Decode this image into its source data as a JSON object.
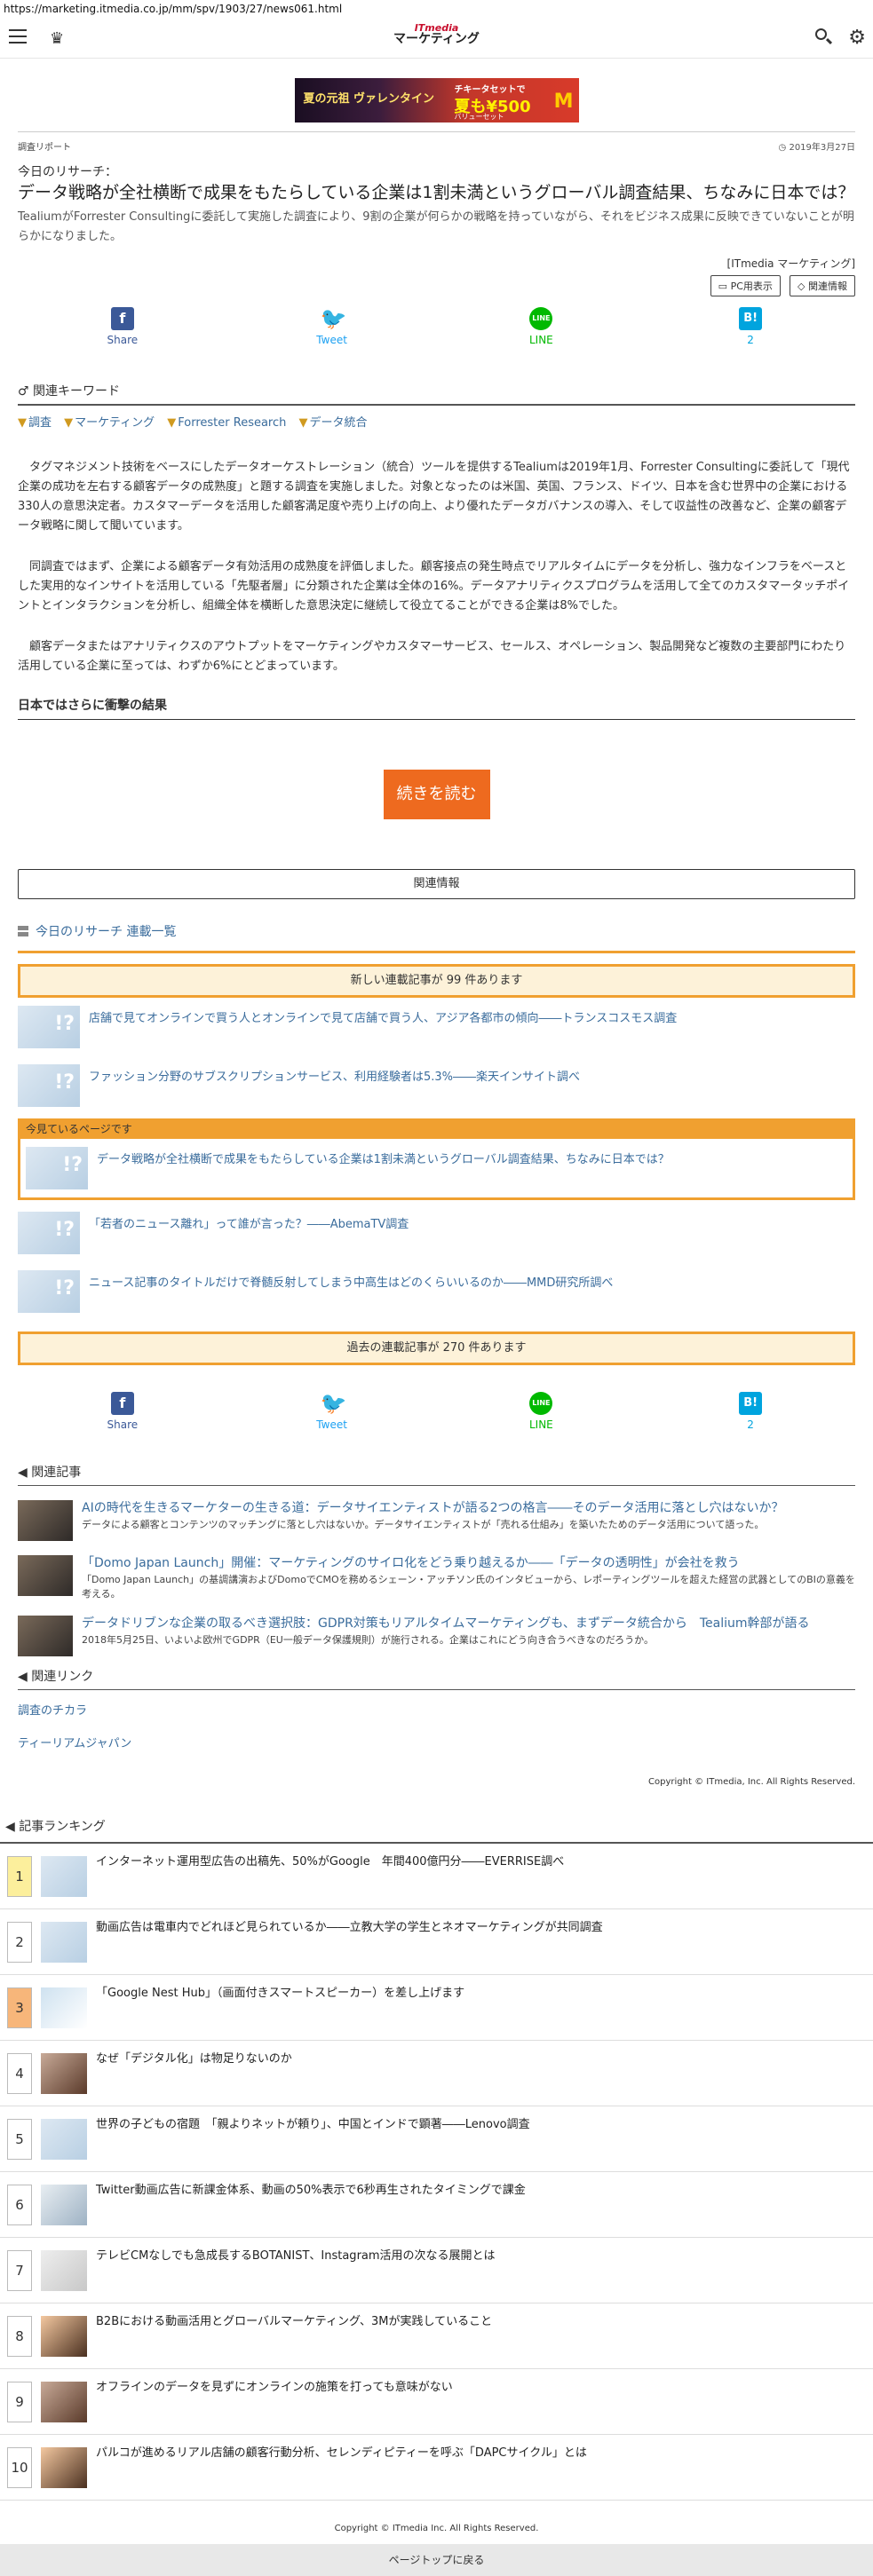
{
  "url": "https://marketing.itmedia.co.jp/mm/spv/1903/27/news061.html",
  "header": {
    "logo_line1": "ITmedia",
    "logo_line2": "マーケティング"
  },
  "ad": {
    "text1": "夏の元祖 ヴァレンタイン",
    "text2": "チキータセットで",
    "text3": "夏も¥500",
    "text4": "バリューセット",
    "mark": "M"
  },
  "meta": {
    "category": "調査リポート",
    "date": "2019年3月27日"
  },
  "article": {
    "kicker": "今日のリサーチ：",
    "title": "データ戦略が全社横断で成果をもたらしている企業は1割未満というグローバル調査結果、ちなみに日本では？",
    "lead": "TealiumがForrester Consultingに委託して実施した調査により、9割の企業が何らかの戦略を持っていながら、それをビジネス成果に反映できていないことが明らかになりました。",
    "byline": "[ITmedia マーケティング]",
    "pc_button": "PC用表示",
    "related_button": "関連情報",
    "paragraphs": [
      "タグマネジメント技術をベースにしたデータオーケストレーション（統合）ツールを提供するTealiumは2019年1月、Forrester Consultingに委託して「現代企業の成功を左右する顧客データの成熟度」と題する調査を実施しました。対象となったのは米国、英国、フランス、ドイツ、日本を含む世界中の企業における330人の意思決定者。カスタマーデータを活用した顧客満足度や売り上げの向上、より優れたデータガバナンスの導入、そして収益性の改善など、企業の顧客データ戦略に関して聞いています。",
      "同調査ではまず、企業による顧客データ有効活用の成熟度を評価しました。顧客接点の発生時点でリアルタイムにデータを分析し、強力なインフラをベースとした実用的なインサイトを活用している「先駆者層」に分類された企業は全体の16%。データアナリティクスプログラムを活用して全てのカスタマータッチポイントとインタラクションを分析し、組織全体を横断した意思決定に継続して役立てることができる企業は8%でした。",
      "顧客データまたはアナリティクスのアウトプットをマーケティングやカスタマーサービス、セールス、オペレーション、製品開発など複数の主要部門にわたり活用している企業に至っては、わずか6%にとどまっています。"
    ],
    "subhead": "日本ではさらに衝撃の結果",
    "more_button": "続きを読む",
    "related_info": "関連情報"
  },
  "share": [
    {
      "label": "Share",
      "icon": "f"
    },
    {
      "label": "Tweet",
      "icon": "🐦"
    },
    {
      "label": "LINE",
      "icon": "LINE"
    },
    {
      "label": "2",
      "icon": "B!"
    }
  ],
  "keywords": {
    "heading": "関連キーワード",
    "items": [
      "調査",
      "マーケティング",
      "Forrester Research",
      "データ統合"
    ]
  },
  "serial": {
    "heading": "今日のリサーチ 連載一覧",
    "new_notice": "新しい連載記事が 99 件あります",
    "old_notice": "過去の連載記事が 270 件あります",
    "current_label": "今見ているページです",
    "items": [
      "店舗で見てオンラインで買う人とオンラインで見て店舗で買う人、アジア各都市の傾向――トランスコスモス調査",
      "ファッション分野のサブスクリプションサービス、利用経験者は5.3%――楽天インサイト調べ",
      "データ戦略が全社横断で成果をもたらしている企業は1割未満というグローバル調査結果、ちなみに日本では？",
      "「若者のニュース離れ」って誰が言った？――AbemaTV調査",
      "ニュース記事のタイトルだけで脊髄反射してしまう中高生はどのくらいいるのか――MMD研究所調べ"
    ]
  },
  "related_articles": {
    "heading": "関連記事",
    "items": [
      {
        "title": "AIの時代を生きるマーケターの生きる道：データサイエンティストが語る2つの格言――そのデータ活用に落とし穴はないか？",
        "desc": "データによる顧客とコンテンツのマッチングに落とし穴はないか。データサイエンティストが「売れる仕組み」を築いたためのデータ活用について語った。"
      },
      {
        "title": "「Domo Japan Launch」開催：マーケティングのサイロ化をどう乗り越えるか――「データの透明性」が会社を救う",
        "desc": "「Domo Japan Launch」の基調講演およびDomoでCMOを務めるシェーン・アッチソン氏のインタビューから、レポーティングツールを超えた経営の武器としてのBIの意義を考える。"
      },
      {
        "title": "データドリブンな企業の取るべき選択肢：GDPR対策もリアルタイムマーケティングも、まずデータ統合から　Tealium幹部が語る",
        "desc": "2018年5月25日、いよいよ欧州でGDPR（EU一般データ保護規則）が施行される。企業はこれにどう向き合うべきなのだろうか。"
      }
    ]
  },
  "related_links": {
    "heading": "関連リンク",
    "items": [
      "調査のチカラ",
      "ティーリアムジャパン"
    ]
  },
  "copyright1": "Copyright © ITmedia, Inc. All Rights Reserved.",
  "ranking": {
    "heading": "記事ランキング",
    "items": [
      {
        "num": "1",
        "title": "インターネット運用型広告の出稿先、50%がGoogle　年間400億円分――EVERRISE調べ"
      },
      {
        "num": "2",
        "title": "動画広告は電車内でどれほど見られているか――立教大学の学生とネオマーケティングが共同調査"
      },
      {
        "num": "3",
        "title": "「Google Nest Hub」（画面付きスマートスピーカー）を差し上げます"
      },
      {
        "num": "4",
        "title": "なぜ「デジタル化」は物足りないのか"
      },
      {
        "num": "5",
        "title": "世界の子どもの宿題　「親よりネットが頼り」、中国とインドで顕著――Lenovo調査"
      },
      {
        "num": "6",
        "title": "Twitter動画広告に新課金体系、動画の50%表示で6秒再生されたタイミングで課金"
      },
      {
        "num": "7",
        "title": "テレビCMなしでも急成長するBOTANIST、Instagram活用の次なる展開とは"
      },
      {
        "num": "8",
        "title": "B2Bにおける動画活用とグローバルマーケティング、3Mが実践していること"
      },
      {
        "num": "9",
        "title": "オフラインのデータを見ずにオンラインの施策を打っても意味がない"
      },
      {
        "num": "10",
        "title": "パルコが進めるリアル店舗の顧客行動分析、セレンディピティーを呼ぶ「DAPCサイクル」とは"
      }
    ]
  },
  "copyright2": "Copyright © ITmedia Inc. All Rights Reserved.",
  "to_top": "ページトップに戻る"
}
